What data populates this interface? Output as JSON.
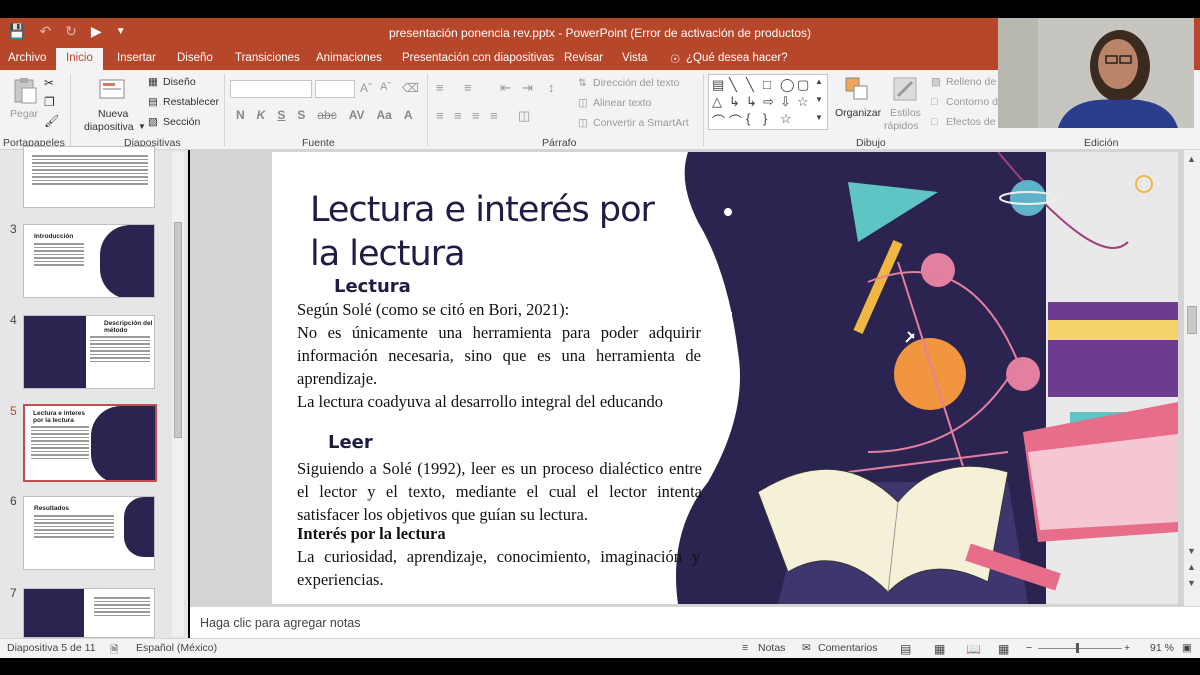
{
  "window": {
    "title": "presentación ponencia rev.pptx - PowerPoint (Error de activación de productos)"
  },
  "tabs": [
    "Archivo",
    "Inicio",
    "Insertar",
    "Diseño",
    "Transiciones",
    "Animaciones",
    "Presentación con diapositivas",
    "Revisar",
    "Vista"
  ],
  "tell_me": "¿Qué desea hacer?",
  "ribbon": {
    "portapapeles": {
      "label": "Portapapeles",
      "paste": "Pegar"
    },
    "diapositivas": {
      "label": "Diapositivas",
      "new_slide_1": "Nueva",
      "new_slide_2": "diapositiva",
      "layout": "Diseño",
      "reset": "Restablecer",
      "section": "Sección"
    },
    "fuente": {
      "label": "Fuente",
      "bold": "N",
      "italic": "K",
      "underline": "S",
      "strike": "abc",
      "shadow": "S"
    },
    "parrafo": {
      "label": "Párrafo",
      "text_direction": "Dirección del texto",
      "align_text": "Alinear texto",
      "smartart": "Convertir a SmartArt"
    },
    "dibujo": {
      "label": "Dibujo",
      "arrange": "Organizar",
      "quick_styles_1": "Estilos",
      "quick_styles_2": "rápidos",
      "fill": "Relleno de",
      "outline": "Contorno d",
      "effects": "Efectos de"
    },
    "edicion": {
      "label": "Edición"
    }
  },
  "thumbnails": [
    {
      "num": "3",
      "title": "Introducción"
    },
    {
      "num": "4",
      "title": "Descripción del método"
    },
    {
      "num": "5",
      "title": "Lectura e interes por la lectura"
    },
    {
      "num": "6",
      "title": "Resultados"
    },
    {
      "num": "7",
      "title": ""
    }
  ],
  "slide": {
    "title": "Lectura e interés por la lectura",
    "sub1": "Lectura",
    "p1": "Según Solé (como se citó en Bori, 2021):",
    "p2": "No es únicamente una herramienta para poder adquirir información necesaria, sino que es una herramienta de aprendizaje.",
    "p3": "La lectura coadyuva al desarrollo integral del educando",
    "sub2": "Leer",
    "p4": "Siguiendo a Solé (1992), leer es un proceso dialéctico entre el lector y el texto, mediante el cual el lector intenta satisfacer los objetivos que guían su lectura.",
    "p5_head": "Interés por la lectura",
    "p5": "La curiosidad, aprendizaje, conocimiento, imaginación y experiencias."
  },
  "notes_placeholder": "Haga clic para agregar notas",
  "status": {
    "slide_count": "Diapositiva 5 de 11",
    "language": "Español (México)",
    "notes": "Notas",
    "comments": "Comentarios",
    "zoom": "91 %"
  },
  "colors": {
    "accent": "#b7472a",
    "slide_dark": "#2b2350",
    "title_text": "#1f1d44"
  }
}
